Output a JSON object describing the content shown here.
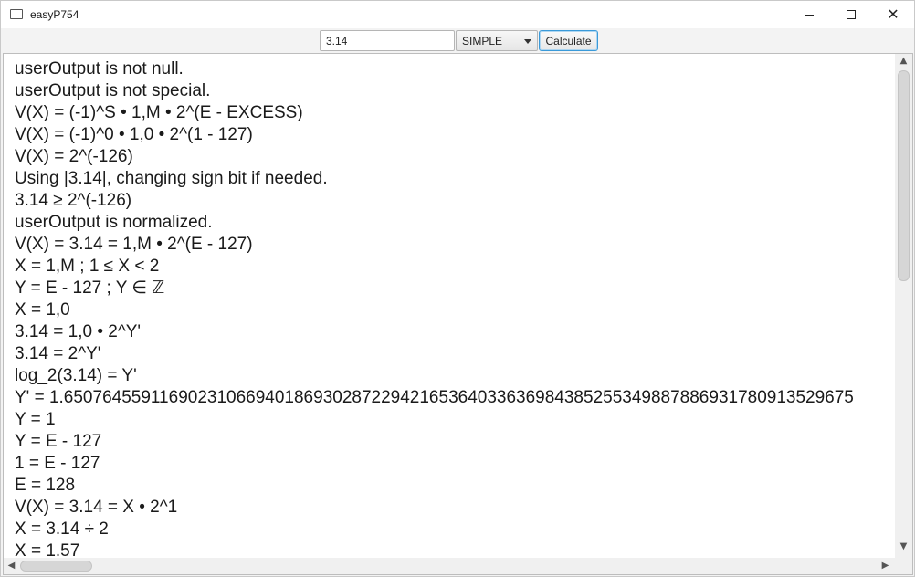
{
  "window": {
    "title": "easyP754",
    "min_icon": "minimize-icon",
    "max_icon": "maximize-icon",
    "close_icon": "close-icon"
  },
  "toolbar": {
    "input_value": "3.14",
    "mode_selected": "SIMPLE",
    "calculate_label": "Calculate"
  },
  "colors": {
    "accent_border": "#3a9ad9",
    "background": "#f3f3f3",
    "text": "#1a1a1a"
  },
  "output": {
    "lines": [
      "userOutput is not null.",
      "userOutput is not special.",
      "V(X) = (-1)^S • 1,M • 2^(E - EXCESS)",
      "V(X) = (-1)^0 • 1,0 • 2^(1 - 127)",
      "V(X) = 2^(-126)",
      "Using |3.14|, changing sign bit if needed.",
      "3.14 ≥ 2^(-126)",
      "userOutput is normalized.",
      "V(X) = 3.14 = 1,M • 2^(E - 127)",
      "X = 1,M ; 1 ≤ X < 2",
      "Y = E - 127 ; Y ∈ ℤ",
      "X = 1,0",
      "3.14 = 1,0 • 2^Y'",
      "3.14 = 2^Y'",
      "log_2(3.14) = Y'",
      "Y' = 1.6507645591169023106694018693028722942165364033636984385255349887886931780913529675",
      "Y = 1",
      "Y = E - 127",
      "1 = E - 127",
      "E = 128",
      "V(X) = 3.14 = X • 2^1",
      "X = 3.14 ÷ 2",
      "X = 1.57"
    ]
  }
}
